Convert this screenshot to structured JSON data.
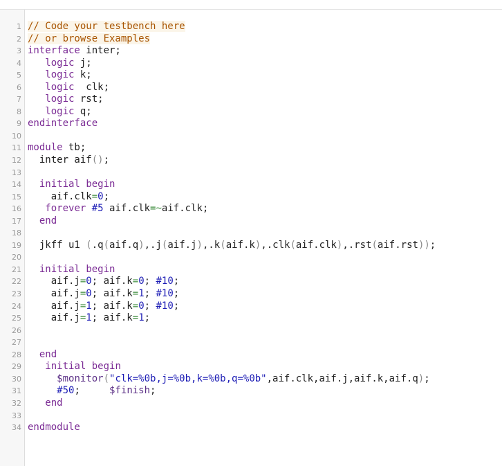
{
  "editor": {
    "lines": [
      {
        "n": "1",
        "tokens": [
          {
            "t": "comment",
            "v": "// Code your testbench here"
          }
        ]
      },
      {
        "n": "2",
        "tokens": [
          {
            "t": "comment",
            "v": "// or browse Examples"
          }
        ]
      },
      {
        "n": "3",
        "tokens": [
          {
            "t": "keyword",
            "v": "interface"
          },
          {
            "t": "plain",
            "v": " inter;"
          }
        ]
      },
      {
        "n": "4",
        "tokens": [
          {
            "t": "plain",
            "v": "   "
          },
          {
            "t": "keyword",
            "v": "logic"
          },
          {
            "t": "plain",
            "v": " j;"
          }
        ]
      },
      {
        "n": "5",
        "tokens": [
          {
            "t": "plain",
            "v": "   "
          },
          {
            "t": "keyword",
            "v": "logic"
          },
          {
            "t": "plain",
            "v": " k;"
          }
        ]
      },
      {
        "n": "6",
        "tokens": [
          {
            "t": "plain",
            "v": "   "
          },
          {
            "t": "keyword",
            "v": "logic"
          },
          {
            "t": "plain",
            "v": "  clk;"
          }
        ]
      },
      {
        "n": "7",
        "tokens": [
          {
            "t": "plain",
            "v": "   "
          },
          {
            "t": "keyword",
            "v": "logic"
          },
          {
            "t": "plain",
            "v": " rst;"
          }
        ]
      },
      {
        "n": "8",
        "tokens": [
          {
            "t": "plain",
            "v": "   "
          },
          {
            "t": "keyword",
            "v": "logic"
          },
          {
            "t": "plain",
            "v": " q;"
          }
        ]
      },
      {
        "n": "9",
        "tokens": [
          {
            "t": "keyword",
            "v": "endinterface"
          }
        ]
      },
      {
        "n": "10",
        "tokens": []
      },
      {
        "n": "11",
        "tokens": [
          {
            "t": "keyword",
            "v": "module"
          },
          {
            "t": "plain",
            "v": " tb;"
          }
        ]
      },
      {
        "n": "12",
        "tokens": [
          {
            "t": "plain",
            "v": "  inter aif"
          },
          {
            "t": "paren",
            "v": "()"
          },
          {
            "t": "plain",
            "v": ";"
          }
        ]
      },
      {
        "n": "13",
        "tokens": []
      },
      {
        "n": "14",
        "tokens": [
          {
            "t": "plain",
            "v": "  "
          },
          {
            "t": "keyword",
            "v": "initial"
          },
          {
            "t": "plain",
            "v": " "
          },
          {
            "t": "keyword",
            "v": "begin"
          }
        ]
      },
      {
        "n": "15",
        "tokens": [
          {
            "t": "plain",
            "v": "    aif.clk"
          },
          {
            "t": "op",
            "v": "="
          },
          {
            "t": "number",
            "v": "0"
          },
          {
            "t": "plain",
            "v": ";"
          }
        ]
      },
      {
        "n": "16",
        "tokens": [
          {
            "t": "plain",
            "v": "   "
          },
          {
            "t": "keyword",
            "v": "forever"
          },
          {
            "t": "plain",
            "v": " "
          },
          {
            "t": "number",
            "v": "#5"
          },
          {
            "t": "plain",
            "v": " aif.clk"
          },
          {
            "t": "op",
            "v": "=~"
          },
          {
            "t": "plain",
            "v": "aif.clk;"
          }
        ]
      },
      {
        "n": "17",
        "tokens": [
          {
            "t": "plain",
            "v": "  "
          },
          {
            "t": "keyword",
            "v": "end"
          }
        ]
      },
      {
        "n": "18",
        "tokens": []
      },
      {
        "n": "19",
        "tokens": [
          {
            "t": "plain",
            "v": "  jkff u1 "
          },
          {
            "t": "paren",
            "v": "("
          },
          {
            "t": "plain",
            "v": ".q"
          },
          {
            "t": "paren",
            "v": "("
          },
          {
            "t": "plain",
            "v": "aif.q"
          },
          {
            "t": "paren",
            "v": ")"
          },
          {
            "t": "plain",
            "v": ",.j"
          },
          {
            "t": "paren",
            "v": "("
          },
          {
            "t": "plain",
            "v": "aif.j"
          },
          {
            "t": "paren",
            "v": ")"
          },
          {
            "t": "plain",
            "v": ",.k"
          },
          {
            "t": "paren",
            "v": "("
          },
          {
            "t": "plain",
            "v": "aif.k"
          },
          {
            "t": "paren",
            "v": ")"
          },
          {
            "t": "plain",
            "v": ",.clk"
          },
          {
            "t": "paren",
            "v": "("
          },
          {
            "t": "plain",
            "v": "aif.clk"
          },
          {
            "t": "paren",
            "v": ")"
          },
          {
            "t": "plain",
            "v": ",.rst"
          },
          {
            "t": "paren",
            "v": "("
          },
          {
            "t": "plain",
            "v": "aif.rst"
          },
          {
            "t": "paren",
            "v": "))"
          },
          {
            "t": "plain",
            "v": ";"
          }
        ]
      },
      {
        "n": "20",
        "tokens": []
      },
      {
        "n": "21",
        "tokens": [
          {
            "t": "plain",
            "v": "  "
          },
          {
            "t": "keyword",
            "v": "initial"
          },
          {
            "t": "plain",
            "v": " "
          },
          {
            "t": "keyword",
            "v": "begin"
          }
        ]
      },
      {
        "n": "22",
        "tokens": [
          {
            "t": "plain",
            "v": "    aif.j"
          },
          {
            "t": "op",
            "v": "="
          },
          {
            "t": "number",
            "v": "0"
          },
          {
            "t": "plain",
            "v": "; aif.k"
          },
          {
            "t": "op",
            "v": "="
          },
          {
            "t": "number",
            "v": "0"
          },
          {
            "t": "plain",
            "v": "; "
          },
          {
            "t": "number",
            "v": "#10"
          },
          {
            "t": "plain",
            "v": ";"
          }
        ]
      },
      {
        "n": "23",
        "tokens": [
          {
            "t": "plain",
            "v": "    aif.j"
          },
          {
            "t": "op",
            "v": "="
          },
          {
            "t": "number",
            "v": "0"
          },
          {
            "t": "plain",
            "v": "; aif.k"
          },
          {
            "t": "op",
            "v": "="
          },
          {
            "t": "number",
            "v": "1"
          },
          {
            "t": "plain",
            "v": "; "
          },
          {
            "t": "number",
            "v": "#10"
          },
          {
            "t": "plain",
            "v": ";"
          }
        ]
      },
      {
        "n": "24",
        "tokens": [
          {
            "t": "plain",
            "v": "    aif.j"
          },
          {
            "t": "op",
            "v": "="
          },
          {
            "t": "number",
            "v": "1"
          },
          {
            "t": "plain",
            "v": "; aif.k"
          },
          {
            "t": "op",
            "v": "="
          },
          {
            "t": "number",
            "v": "0"
          },
          {
            "t": "plain",
            "v": "; "
          },
          {
            "t": "number",
            "v": "#10"
          },
          {
            "t": "plain",
            "v": ";"
          }
        ]
      },
      {
        "n": "25",
        "tokens": [
          {
            "t": "plain",
            "v": "    aif.j"
          },
          {
            "t": "op",
            "v": "="
          },
          {
            "t": "number",
            "v": "1"
          },
          {
            "t": "plain",
            "v": "; aif.k"
          },
          {
            "t": "op",
            "v": "="
          },
          {
            "t": "number",
            "v": "1"
          },
          {
            "t": "plain",
            "v": ";"
          }
        ]
      },
      {
        "n": "26",
        "tokens": []
      },
      {
        "n": "27",
        "tokens": []
      },
      {
        "n": "28",
        "tokens": [
          {
            "t": "plain",
            "v": "  "
          },
          {
            "t": "keyword",
            "v": "end"
          }
        ]
      },
      {
        "n": "29",
        "tokens": [
          {
            "t": "plain",
            "v": "   "
          },
          {
            "t": "keyword",
            "v": "initial"
          },
          {
            "t": "plain",
            "v": " "
          },
          {
            "t": "keyword",
            "v": "begin"
          }
        ]
      },
      {
        "n": "30",
        "tokens": [
          {
            "t": "plain",
            "v": "     "
          },
          {
            "t": "sysfunc",
            "v": "$monitor"
          },
          {
            "t": "paren",
            "v": "("
          },
          {
            "t": "string",
            "v": "\"clk=%0b,j=%0b,k=%0b,q=%0b\""
          },
          {
            "t": "plain",
            "v": ",aif.clk,aif.j,aif.k,aif.q"
          },
          {
            "t": "paren",
            "v": ")"
          },
          {
            "t": "plain",
            "v": ";"
          }
        ]
      },
      {
        "n": "31",
        "tokens": [
          {
            "t": "plain",
            "v": "     "
          },
          {
            "t": "number",
            "v": "#50"
          },
          {
            "t": "plain",
            "v": ";     "
          },
          {
            "t": "sysfunc",
            "v": "$finish"
          },
          {
            "t": "plain",
            "v": ";"
          }
        ]
      },
      {
        "n": "32",
        "tokens": [
          {
            "t": "plain",
            "v": "   "
          },
          {
            "t": "keyword",
            "v": "end"
          }
        ]
      },
      {
        "n": "33",
        "tokens": []
      },
      {
        "n": "34",
        "tokens": [
          {
            "t": "keyword",
            "v": "endmodule"
          }
        ]
      }
    ]
  }
}
